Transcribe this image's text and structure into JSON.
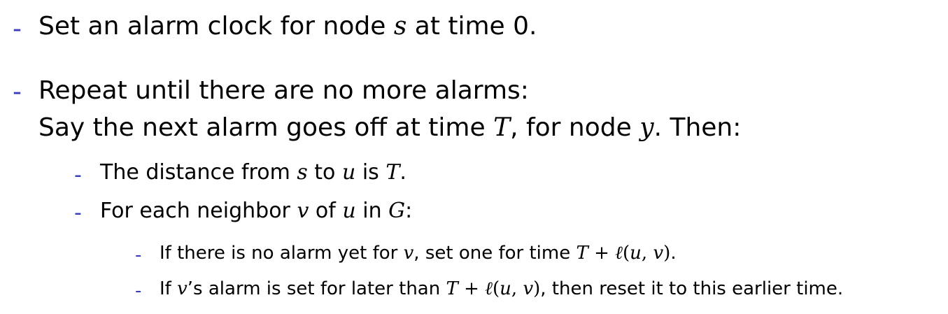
{
  "bullet_char": "-",
  "accent_color": "#3c3cb4",
  "items": [
    {
      "level": 1,
      "parts": [
        {
          "t": "Set an alarm clock for node "
        },
        {
          "m": "s"
        },
        {
          "t": " at time 0."
        }
      ]
    },
    {
      "level": 1,
      "parts": [
        {
          "t": "Repeat until there are no more alarms:"
        }
      ]
    },
    {
      "level": 1,
      "continuation": true,
      "parts": [
        {
          "t": "Say the next alarm goes off at time "
        },
        {
          "m": "T"
        },
        {
          "t": ", for node "
        },
        {
          "m": "y"
        },
        {
          "t": ". Then:"
        }
      ]
    },
    {
      "level": 2,
      "parts": [
        {
          "t": "The distance from "
        },
        {
          "m": "s"
        },
        {
          "t": " to "
        },
        {
          "m": "u"
        },
        {
          "t": " is "
        },
        {
          "m": "T"
        },
        {
          "t": "."
        }
      ]
    },
    {
      "level": 2,
      "parts": [
        {
          "t": "For each neighbor "
        },
        {
          "m": "v"
        },
        {
          "t": " of "
        },
        {
          "m": "u"
        },
        {
          "t": " in "
        },
        {
          "m": "G"
        },
        {
          "t": ":"
        }
      ]
    },
    {
      "level": 3,
      "parts": [
        {
          "t": "If there is no alarm yet for "
        },
        {
          "m": "v"
        },
        {
          "t": ", set one for time "
        },
        {
          "m": "T"
        },
        {
          "op": " + "
        },
        {
          "m": "ℓ"
        },
        {
          "op": "("
        },
        {
          "m": "u"
        },
        {
          "op": ", "
        },
        {
          "m": "v"
        },
        {
          "op": ")"
        },
        {
          "t": "."
        }
      ]
    },
    {
      "level": 3,
      "parts": [
        {
          "t": "If "
        },
        {
          "m": "v"
        },
        {
          "t": "’s alarm is set for later than "
        },
        {
          "m": "T"
        },
        {
          "op": " + "
        },
        {
          "m": "ℓ"
        },
        {
          "op": "("
        },
        {
          "m": "u"
        },
        {
          "op": ", "
        },
        {
          "m": "v"
        },
        {
          "op": ")"
        },
        {
          "t": ", then reset it to this earlier time."
        }
      ]
    }
  ]
}
